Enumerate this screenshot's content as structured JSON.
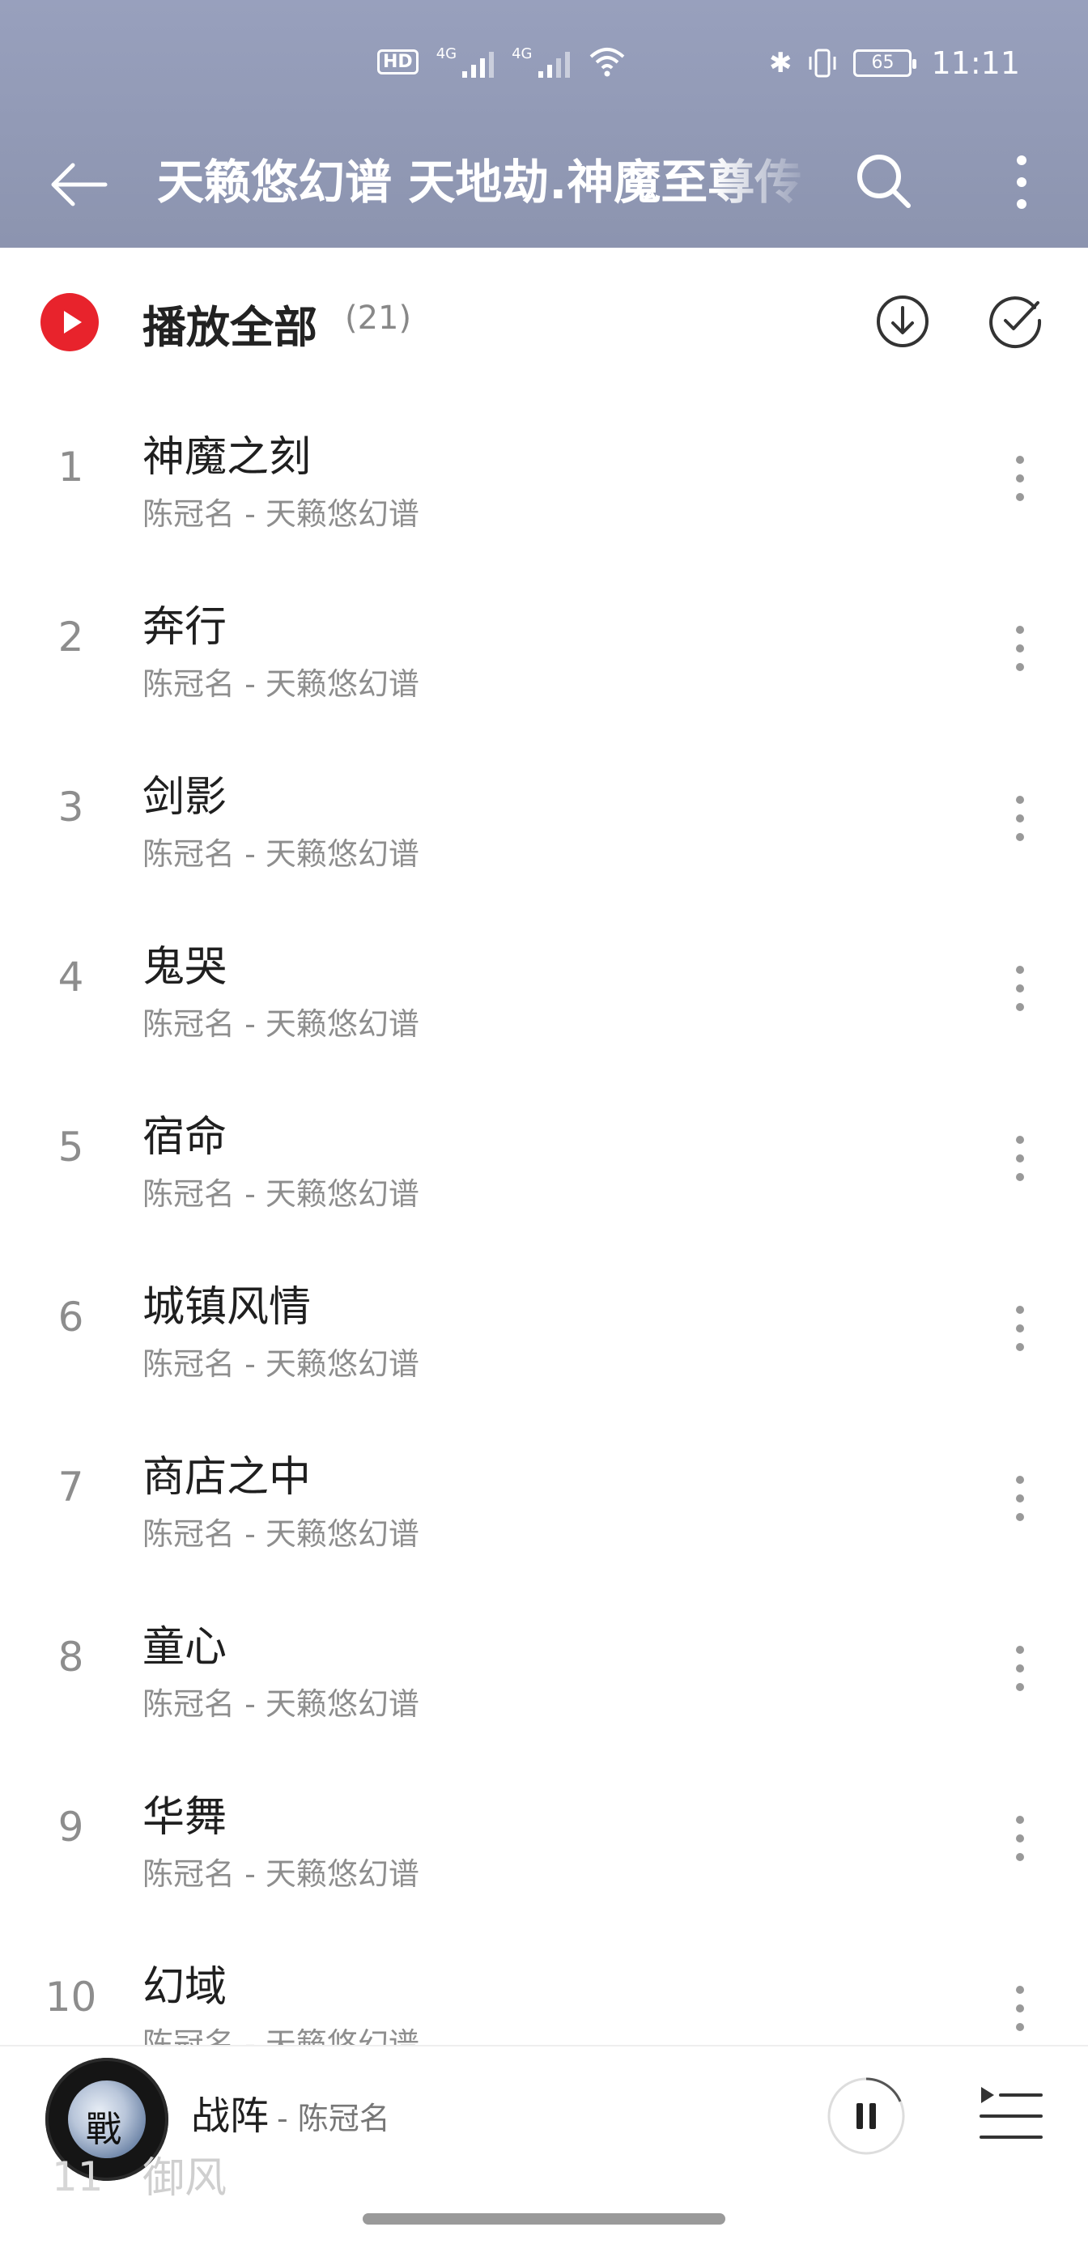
{
  "status_bar": {
    "time": "11:11",
    "battery": "65",
    "hd_label": "HD",
    "net1": "4G",
    "net2": "4G"
  },
  "header": {
    "title": "天籁悠幻谱 天地劫.神魔至尊传"
  },
  "play_all": {
    "label": "播放全部",
    "count": "(21)"
  },
  "songs": [
    {
      "num": "1",
      "title": "神魔之刻",
      "subtitle": "陈冠名 - 天籁悠幻谱"
    },
    {
      "num": "2",
      "title": "奔行",
      "subtitle": "陈冠名 - 天籁悠幻谱"
    },
    {
      "num": "3",
      "title": "剑影",
      "subtitle": "陈冠名 - 天籁悠幻谱"
    },
    {
      "num": "4",
      "title": "鬼哭",
      "subtitle": "陈冠名 - 天籁悠幻谱"
    },
    {
      "num": "5",
      "title": "宿命",
      "subtitle": "陈冠名 - 天籁悠幻谱"
    },
    {
      "num": "6",
      "title": "城镇风情",
      "subtitle": "陈冠名 - 天籁悠幻谱"
    },
    {
      "num": "7",
      "title": "商店之中",
      "subtitle": "陈冠名 - 天籁悠幻谱"
    },
    {
      "num": "8",
      "title": "童心",
      "subtitle": "陈冠名 - 天籁悠幻谱"
    },
    {
      "num": "9",
      "title": "华舞",
      "subtitle": "陈冠名 - 天籁悠幻谱"
    },
    {
      "num": "10",
      "title": "幻域",
      "subtitle": "陈冠名 - 天籁悠幻谱"
    }
  ],
  "partial_row": {
    "num": "11",
    "title": "御风"
  },
  "player": {
    "song": "战阵",
    "artist": "- 陈冠名"
  },
  "colors": {
    "header_bg": "#98a0bd",
    "accent_red": "#e8232c"
  }
}
